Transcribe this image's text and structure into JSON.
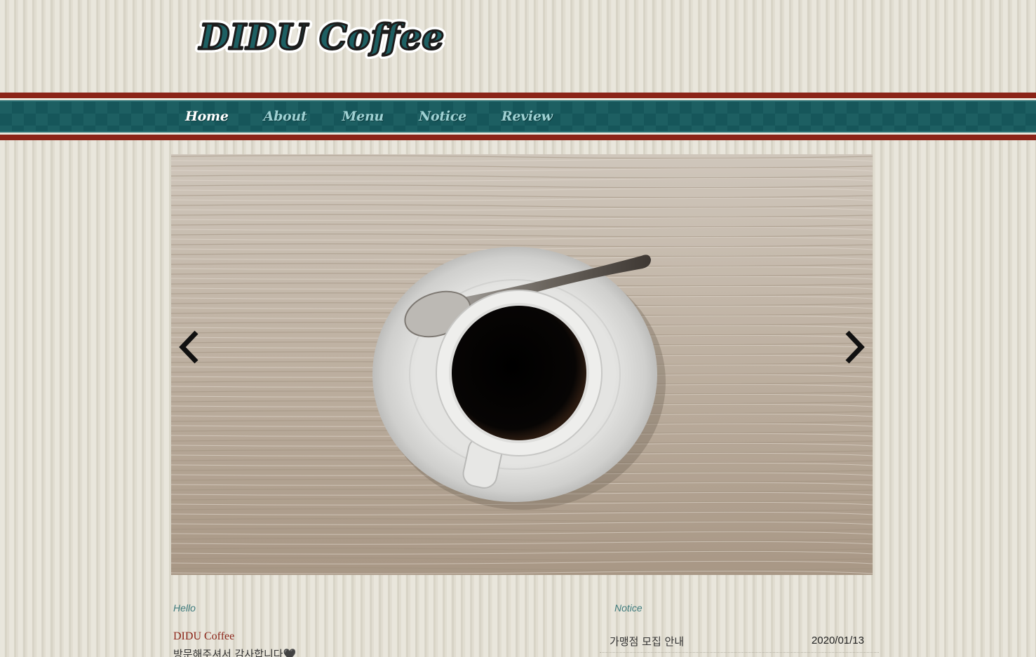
{
  "header": {
    "logo_text": "DIDU Coffee"
  },
  "nav": {
    "items": [
      {
        "label": "Home",
        "active": true
      },
      {
        "label": "About",
        "active": false
      },
      {
        "label": "Menu",
        "active": false
      },
      {
        "label": "Notice",
        "active": false
      },
      {
        "label": "Review",
        "active": false
      }
    ]
  },
  "slider": {
    "image": "coffee-cup-on-wooden-table",
    "prev_icon": "chevron-left-icon",
    "next_icon": "chevron-right-icon"
  },
  "hello": {
    "title": "Hello",
    "name": "DIDU Coffee",
    "message": "방문해주셔서 감사합니다🖤"
  },
  "notice": {
    "title": "Notice",
    "rows": [
      {
        "title": "가맹점 모집 안내",
        "date": "2020/01/13"
      }
    ]
  },
  "colors": {
    "accent_red": "#8b2418",
    "accent_teal": "#1d5f62",
    "nav_text": "#9fd1d3",
    "background": "#e4e1d6"
  }
}
